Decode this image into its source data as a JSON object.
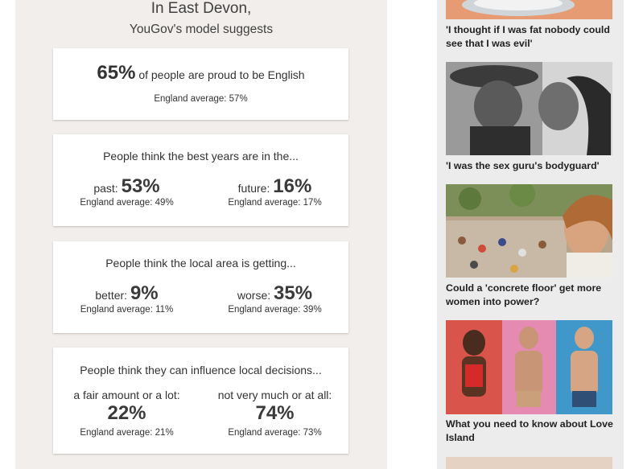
{
  "header": {
    "line1": "In East Devon,",
    "line2": "YouGov's model suggests"
  },
  "cards": {
    "proud": {
      "percent": "65%",
      "text": " of people are proud to be English",
      "average": "England average: 57%"
    },
    "best_years": {
      "question": "People think the best years are in the...",
      "left": {
        "label": "past: ",
        "percent": "53%",
        "average": "England average: 49%"
      },
      "right": {
        "label": "future: ",
        "percent": "16%",
        "average": "England average: 17%"
      }
    },
    "local_area": {
      "question": "People think the local area is getting...",
      "left": {
        "label": "better: ",
        "percent": "9%",
        "average": "England average: 11%"
      },
      "right": {
        "label": "worse: ",
        "percent": "35%",
        "average": "England average: 39%"
      }
    },
    "influence": {
      "question": "People think they can influence local decisions...",
      "left": {
        "label": "a fair amount or a lot:",
        "percent": "22%",
        "average": "England average: 21%"
      },
      "right": {
        "label": "not very much or at all:",
        "percent": "74%",
        "average": "England average: 73%"
      }
    }
  },
  "promos": [
    {
      "caption": "'I thought if I was fat nobody could see that I was evil'"
    },
    {
      "caption": "'I was the sex guru's bodyguard'"
    },
    {
      "caption": "Could a 'concrete floor' get more women into power?"
    },
    {
      "caption": "What you need to know about Love Island"
    }
  ]
}
